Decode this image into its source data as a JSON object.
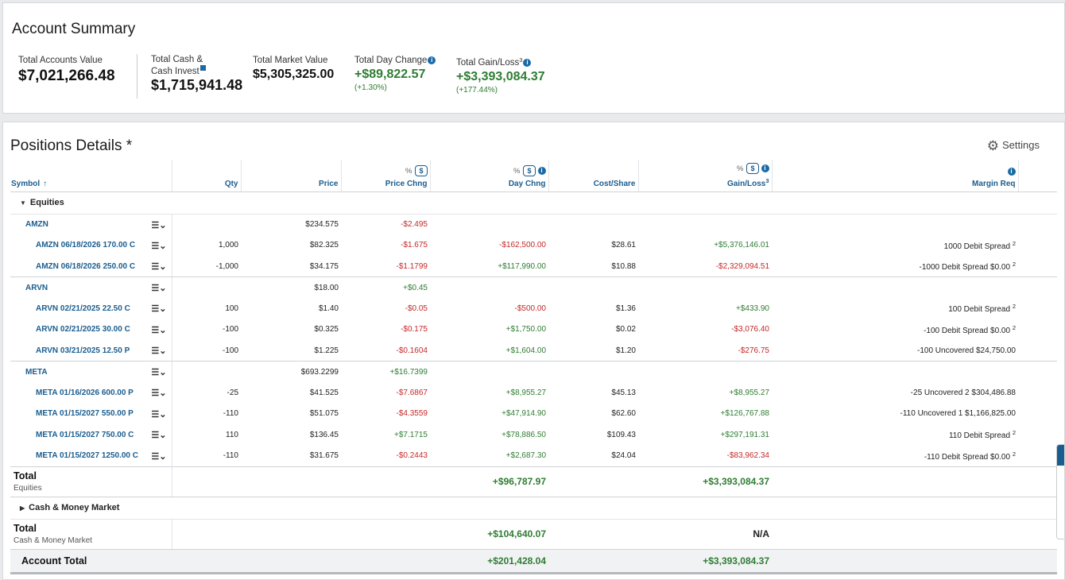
{
  "summary": {
    "title": "Account Summary",
    "metrics": [
      {
        "label": "Total Accounts Value",
        "value": "$7,021,266.48"
      },
      {
        "label": "Total Cash &",
        "label2": "Cash Invest",
        "value": "$1,715,941.48"
      },
      {
        "label": "Total Market Value",
        "value": "$5,305,325.00"
      },
      {
        "label": "Total Day Change",
        "value": "+$89,822.57",
        "sub": "(+1.30%)"
      },
      {
        "label": "Total Gain/Loss",
        "sup": "3",
        "value": "+$3,393,084.37",
        "sub": "(+177.44%)"
      }
    ]
  },
  "positions": {
    "title": "Positions Details *",
    "settings_label": "Settings",
    "columns": {
      "symbol": "Symbol",
      "qty": "Qty",
      "price": "Price",
      "price_chng": "Price Chng",
      "day_chng": "Day Chng",
      "cost_share": "Cost/Share",
      "gain_loss": "Gain/Loss",
      "gain_loss_sup": "3",
      "margin_req": "Margin Req",
      "pct": "%",
      "dollar": "$"
    },
    "equities_label": "Equities",
    "rows": [
      {
        "sym": "AMZN",
        "parent": true,
        "qty": "",
        "price": "$234.575",
        "pchg": "-$2.495",
        "dchg": "",
        "cost": "",
        "gl": "",
        "margin": ""
      },
      {
        "sym": "AMZN 06/18/2026 170.00 C",
        "qty": "1,000",
        "price": "$82.325",
        "pchg": "-$1.675",
        "dchg": "-$162,500.00",
        "cost": "$28.61",
        "gl": "+$5,376,146.01",
        "margin": "1000  Debit Spread",
        "msup": "2"
      },
      {
        "sym": "AMZN 06/18/2026 250.00 C",
        "end": true,
        "qty": "-1,000",
        "price": "$34.175",
        "pchg": "-$1.1799",
        "dchg": "+$117,990.00",
        "cost": "$10.88",
        "gl": "-$2,329,094.51",
        "margin": "-1000  Debit Spread $0.00",
        "msup": "2"
      },
      {
        "sym": "ARVN",
        "parent": true,
        "qty": "",
        "price": "$18.00",
        "pchg": "+$0.45",
        "dchg": "",
        "cost": "",
        "gl": "",
        "margin": ""
      },
      {
        "sym": "ARVN 02/21/2025 22.50 C",
        "qty": "100",
        "price": "$1.40",
        "pchg": "-$0.05",
        "dchg": "-$500.00",
        "cost": "$1.36",
        "gl": "+$433.90",
        "margin": "100  Debit Spread",
        "msup": "2"
      },
      {
        "sym": "ARVN 02/21/2025 30.00 C",
        "qty": "-100",
        "price": "$0.325",
        "pchg": "-$0.175",
        "dchg": "+$1,750.00",
        "cost": "$0.02",
        "gl": "-$3,076.40",
        "margin": "-100  Debit Spread $0.00",
        "msup": "2"
      },
      {
        "sym": "ARVN 03/21/2025 12.50 P",
        "end": true,
        "qty": "-100",
        "price": "$1.225",
        "pchg": "-$0.1604",
        "dchg": "+$1,604.00",
        "cost": "$1.20",
        "gl": "-$276.75",
        "margin": "-100  Uncovered $24,750.00"
      },
      {
        "sym": "META",
        "parent": true,
        "qty": "",
        "price": "$693.2299",
        "pchg": "+$16.7399",
        "dchg": "",
        "cost": "",
        "gl": "",
        "margin": ""
      },
      {
        "sym": "META 01/16/2026 600.00 P",
        "qty": "-25",
        "price": "$41.525",
        "pchg": "-$7.6867",
        "dchg": "+$8,955.27",
        "cost": "$45.13",
        "gl": "+$8,955.27",
        "margin": "-25  Uncovered 2 $304,486.88"
      },
      {
        "sym": "META 01/15/2027 550.00 P",
        "qty": "-110",
        "price": "$51.075",
        "pchg": "-$4.3559",
        "dchg": "+$47,914.90",
        "cost": "$62.60",
        "gl": "+$126,767.88",
        "margin": "-110  Uncovered 1 $1,166,825.00"
      },
      {
        "sym": "META 01/15/2027 750.00 C",
        "qty": "110",
        "price": "$136.45",
        "pchg": "+$7.1715",
        "dchg": "+$78,886.50",
        "cost": "$109.43",
        "gl": "+$297,191.31",
        "margin": "110  Debit Spread",
        "msup": "2"
      },
      {
        "sym": "META 01/15/2027 1250.00 C",
        "end": true,
        "qty": "-110",
        "price": "$31.675",
        "pchg": "-$0.2443",
        "dchg": "+$2,687.30",
        "cost": "$24.04",
        "gl": "-$83,962.34",
        "margin": "-110  Debit Spread $0.00",
        "msup": "2"
      }
    ],
    "total_equities": {
      "label": "Total",
      "sub": "Equities",
      "day_chng": "+$96,787.97",
      "gain_loss": "+$3,393,084.37"
    },
    "cash_label": "Cash & Money Market",
    "total_cash": {
      "label": "Total",
      "sub": "Cash & Money Market",
      "day_chng": "+$104,640.07",
      "gain_loss": "N/A"
    },
    "account_total": {
      "label": "Account Total",
      "day_chng": "+$201,428.04",
      "gain_loss": "+$3,393,084.37"
    }
  }
}
